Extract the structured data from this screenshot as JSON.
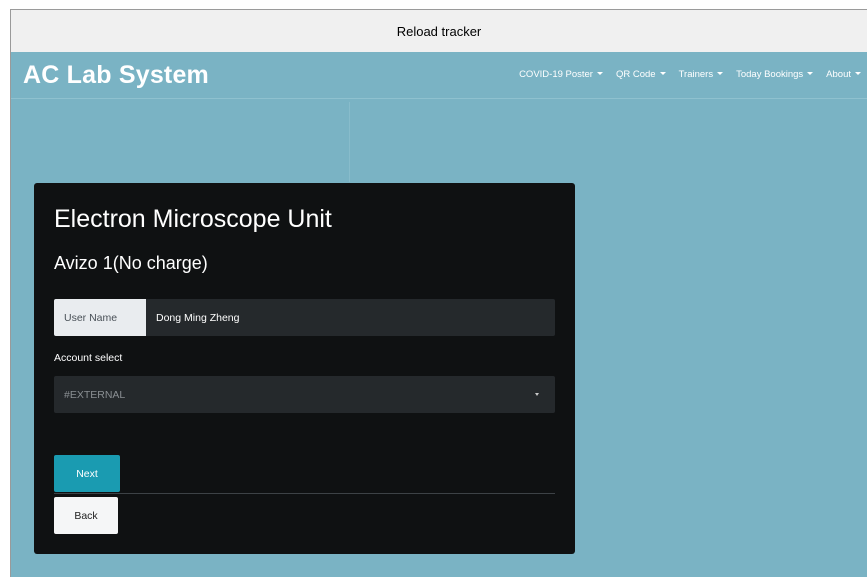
{
  "window": {
    "title": "Reload tracker"
  },
  "navbar": {
    "brand": "AC Lab System",
    "items": [
      {
        "label": "COVID-19 Poster"
      },
      {
        "label": "QR Code"
      },
      {
        "label": "Trainers"
      },
      {
        "label": "Today Bookings"
      },
      {
        "label": "About"
      }
    ]
  },
  "form": {
    "title": "Electron Microscope Unit",
    "subtitle": "Avizo 1(No charge)",
    "user_name_label": "User Name",
    "user_name_value": "Dong Ming Zheng",
    "account_label": "Account select",
    "account_selected": "#EXTERNAL",
    "next_label": "Next",
    "back_label": "Back"
  },
  "colors": {
    "background": "#7ab3c4",
    "card": "#0f1112",
    "primary_button": "#1a9bb1"
  }
}
